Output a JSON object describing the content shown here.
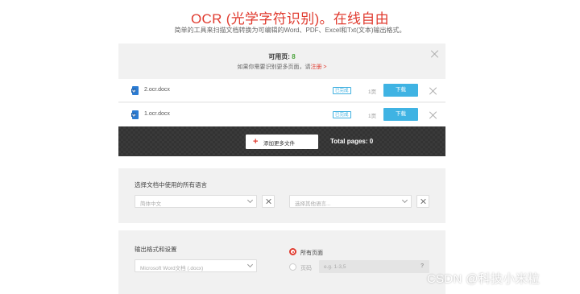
{
  "header": {
    "title": "OCR (光学字符识别)。在线自由",
    "subtitle": "简单的工具来扫描文档转换为可编辑的Word、PDF、Excel和Txt(文本)输出格式。"
  },
  "upload_panel": {
    "pages_label": "可用页:",
    "pages_value": "8",
    "hint_prefix": "如果你需要识别更多页面，请",
    "hint_link": "注册",
    "hint_arrow": ">",
    "files": [
      {
        "name": "2.ocr.docx",
        "status": "已完成",
        "pages": "1页",
        "download_label": "下载"
      },
      {
        "name": "1.ocr.docx",
        "status": "已完成",
        "pages": "1页",
        "download_label": "下载"
      }
    ],
    "add_files_label": "添加更多文件",
    "total_pages_label": "Total pages: 0"
  },
  "language_panel": {
    "label": "选择文档中使用的所有语言",
    "primary_language": "简体中文",
    "secondary_placeholder": "选择其他语言..."
  },
  "output_panel": {
    "label": "输出格式和设置",
    "format_value": "Microsoft Word文档 (.docx)",
    "radio_all_pages": "所有页面",
    "radio_page_range": "页码",
    "range_placeholder": "e.g. 1-3,5",
    "help_label": "?"
  },
  "watermark": "CSDN @科技小米粒",
  "colors": {
    "brand_red": "#e03b2f",
    "accent_blue": "#3fb3e3",
    "success_green": "#4aa33a"
  }
}
